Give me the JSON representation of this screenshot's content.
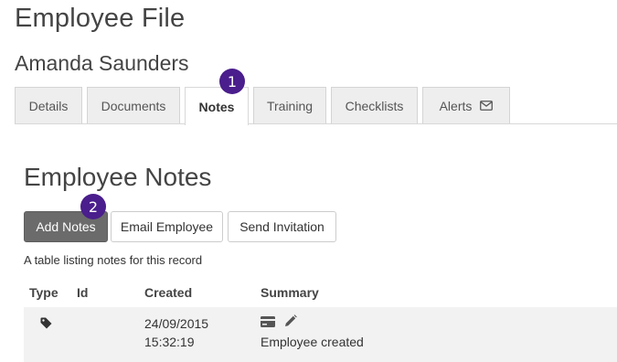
{
  "header": {
    "title": "Employee File",
    "employee_name": "Amanda Saunders"
  },
  "tabs": [
    {
      "label": "Details",
      "active": false
    },
    {
      "label": "Documents",
      "active": false
    },
    {
      "label": "Notes",
      "active": true
    },
    {
      "label": "Training",
      "active": false
    },
    {
      "label": "Checklists",
      "active": false
    },
    {
      "label": "Alerts",
      "active": false,
      "icon": "envelope-icon"
    }
  ],
  "callouts": [
    "1",
    "2"
  ],
  "notes_section": {
    "title": "Employee Notes",
    "buttons": {
      "add_notes": "Add Notes",
      "email_employee": "Email Employee",
      "send_invitation": "Send Invitation"
    },
    "caption": "A table listing notes for this record"
  },
  "table": {
    "columns": [
      "Type",
      "Id",
      "Created",
      "Summary"
    ],
    "rows": [
      {
        "type_icon": "tag-icon",
        "id": "",
        "created_date": "24/09/2015",
        "created_time": "15:32:19",
        "summary_icons": [
          "card-icon",
          "pencil-icon"
        ],
        "summary": "Employee created"
      }
    ]
  },
  "colors": {
    "callout": "#4a1e8c",
    "primary_button": "#6b6b6b",
    "tab_inactive": "#eeeeee",
    "row_background": "#f2f2f2"
  }
}
